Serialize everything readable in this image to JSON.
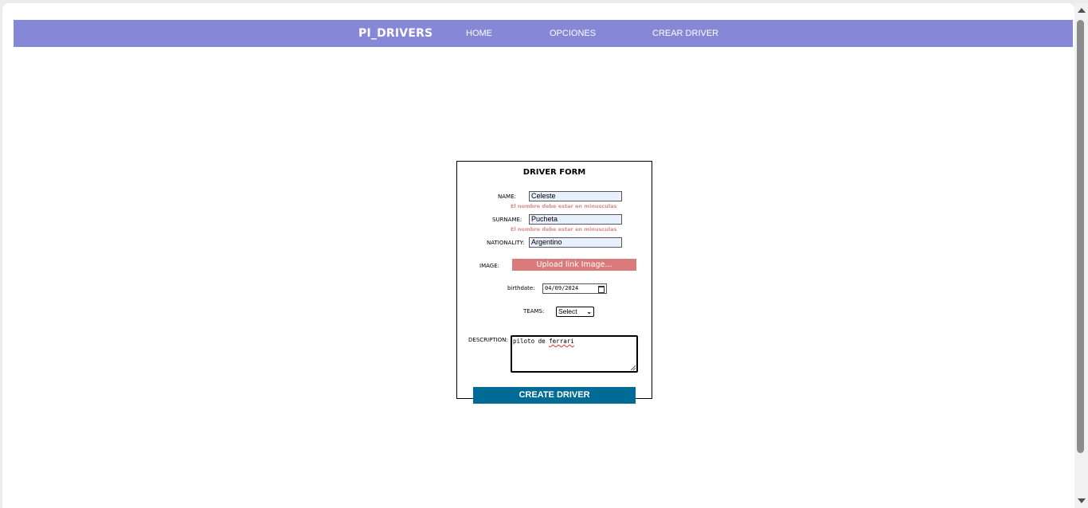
{
  "nav": {
    "brand": "PI_DRIVERS",
    "links": [
      "HOME",
      "OPCIONES",
      "CREAR DRIVER"
    ]
  },
  "form": {
    "title": "DRIVER FORM",
    "name_label": "NAME:",
    "name_value": "Celeste",
    "name_error": "El nombre debe estar en minusculas",
    "surname_label": "SURNAME:",
    "surname_value": "Pucheta",
    "surname_error": "El nombre debe estar en minusculas",
    "nationality_label": "NATIONALITY:",
    "nationality_value": "Argentino",
    "image_label": "IMAGE:",
    "upload_button": "Upload link Image...",
    "birthdate_label": "birthdate:",
    "birthdate_value": "04/09/2024",
    "teams_label": "TEAMS:",
    "teams_selected": "Select",
    "description_label": "DESCRIPTION:",
    "description_value_prefix": "piloto de ",
    "description_value_misspelled": "ferrari",
    "submit_button": "CREATE DRIVER"
  },
  "colors": {
    "navbar": "#8787d8",
    "error_text": "#e08a8a",
    "upload_button": "#d97b7b",
    "submit_button": "#006b94",
    "autofill_input": "#e8f0fe"
  }
}
